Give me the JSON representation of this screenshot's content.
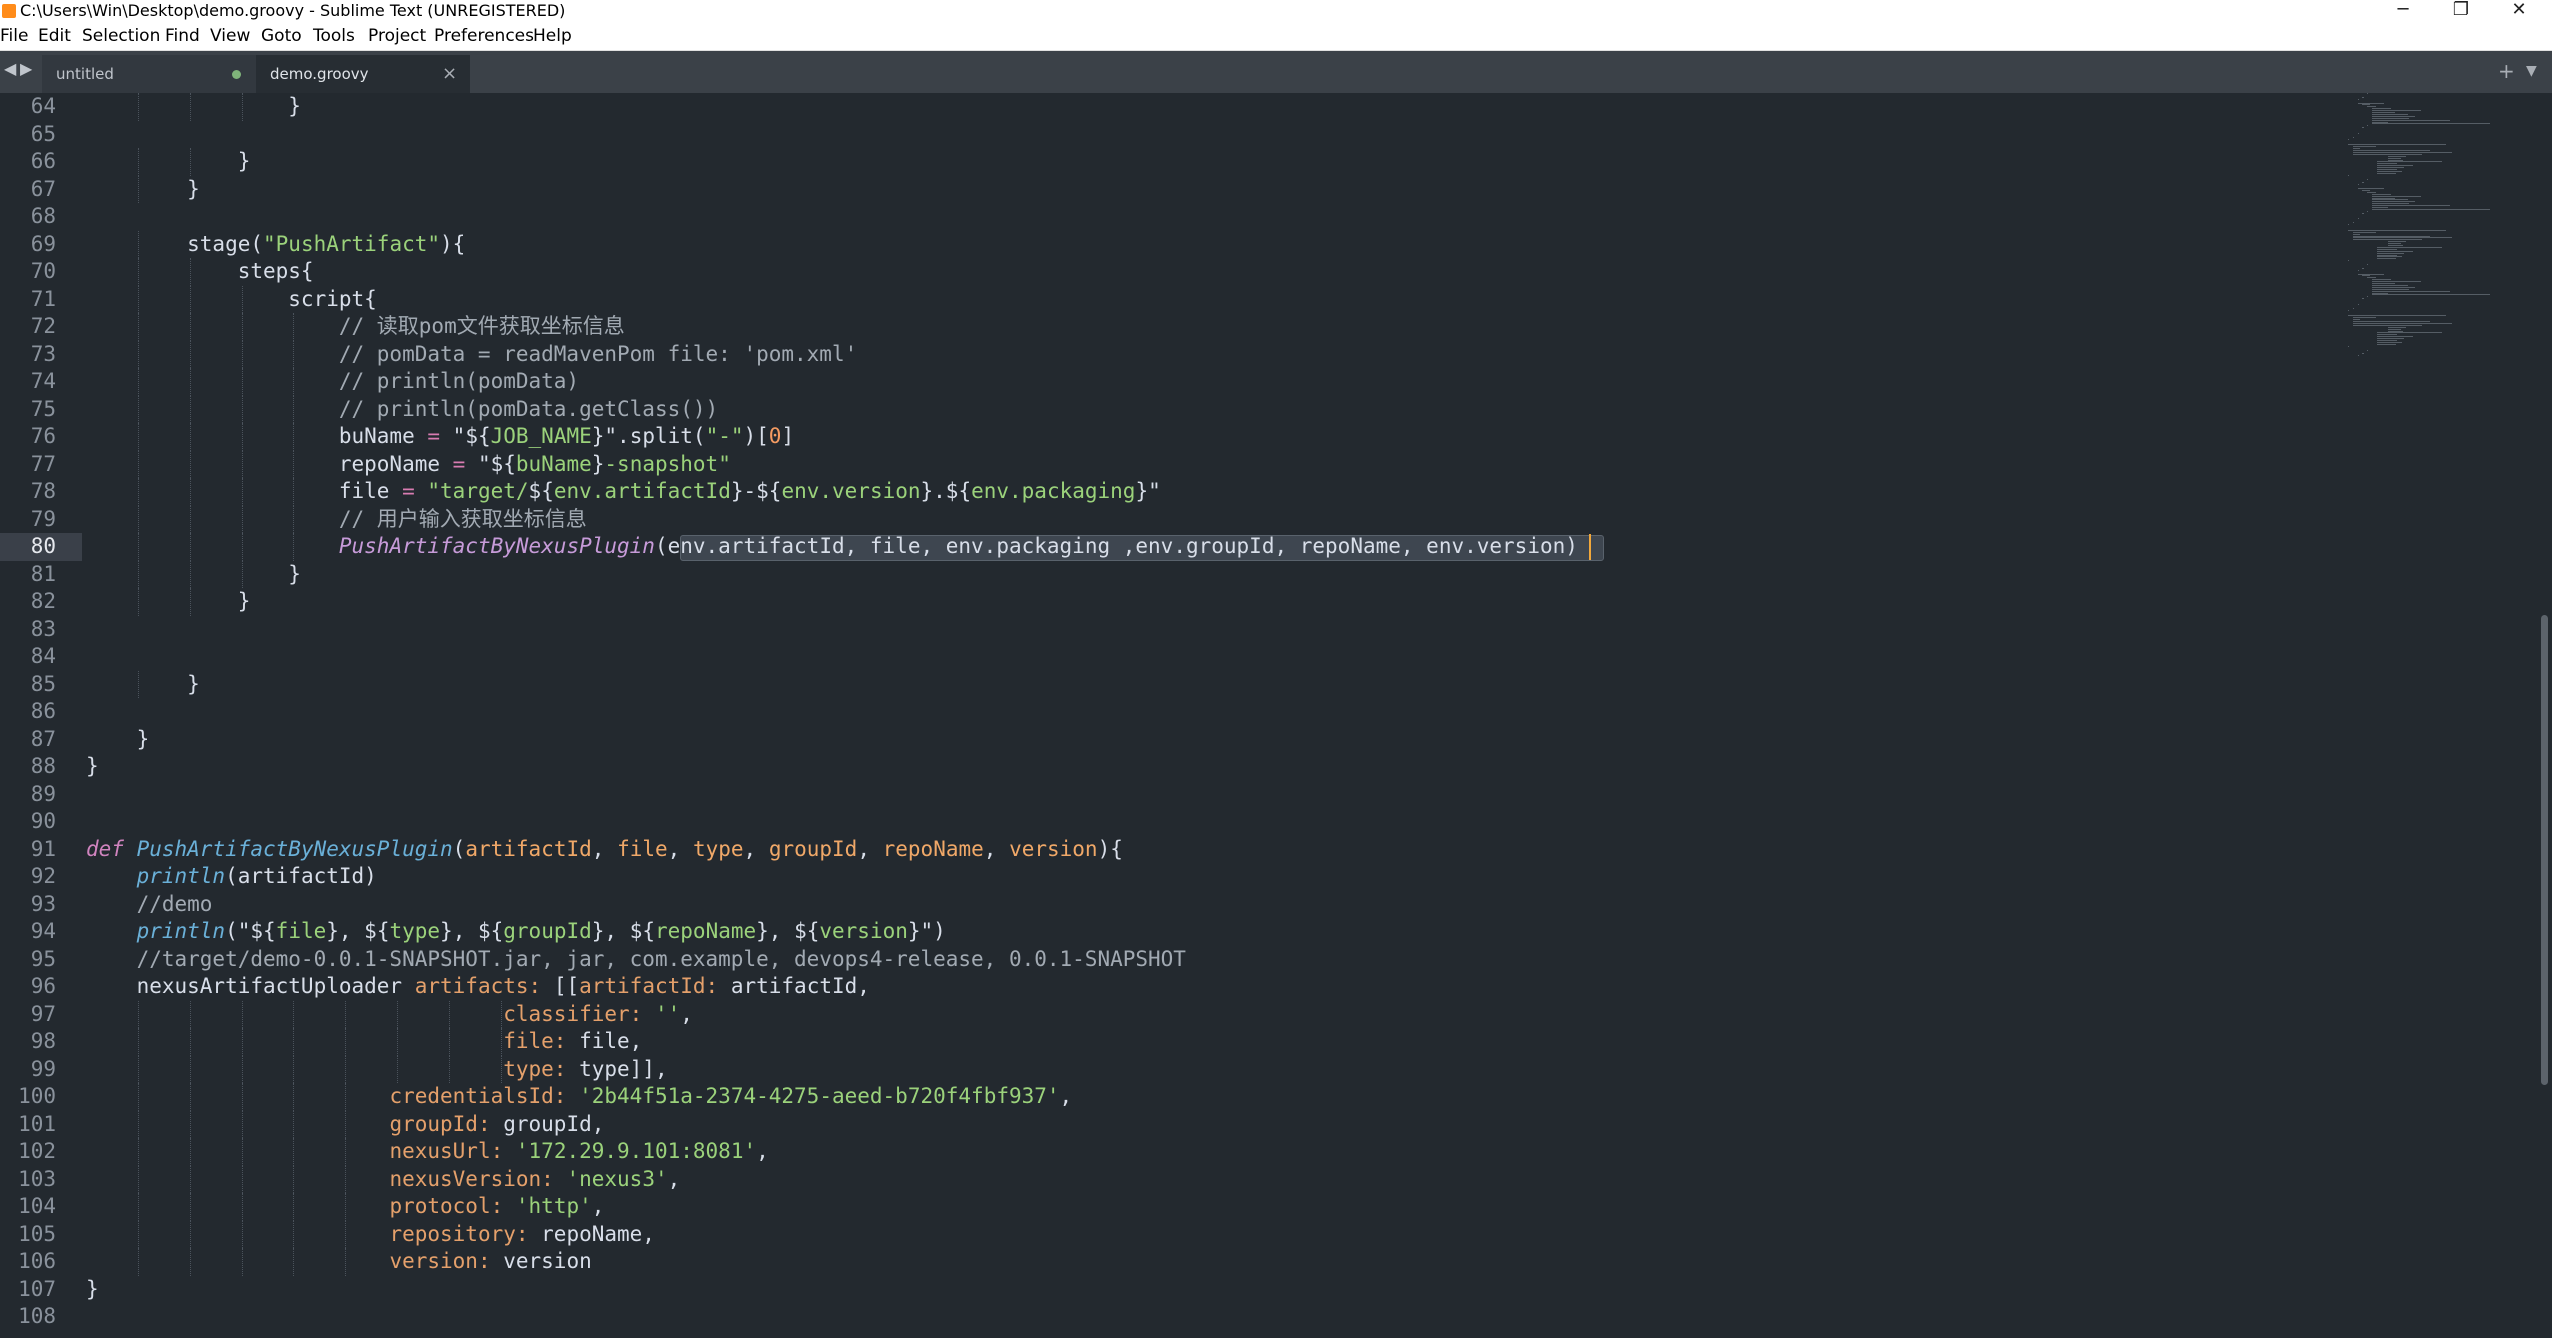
{
  "window": {
    "title": "C:\\Users\\Win\\Desktop\\demo.groovy - Sublime Text (UNREGISTERED)",
    "controls": {
      "minimize": "─",
      "maximize": "❐",
      "close": "✕"
    }
  },
  "menu": [
    "File",
    "Edit",
    "Selection",
    "Find",
    "View",
    "Goto",
    "Tools",
    "Project",
    "Preferences",
    "Help"
  ],
  "tabs": {
    "nav_back": "◀",
    "nav_forward": "▶",
    "items": [
      {
        "label": "untitled",
        "active": false,
        "dirty": true
      },
      {
        "label": "demo.groovy",
        "active": true,
        "close": "×"
      }
    ],
    "new_tab": "+",
    "tab_list": "▼"
  },
  "editor": {
    "current_line": 80,
    "line_numbers": [
      64,
      65,
      66,
      67,
      68,
      69,
      70,
      71,
      72,
      73,
      74,
      75,
      76,
      77,
      78,
      79,
      80,
      81,
      82,
      83,
      84,
      85,
      86,
      87,
      88,
      89,
      90,
      91,
      92,
      93,
      94,
      95,
      96,
      97,
      98,
      99,
      100,
      101,
      102,
      103,
      104,
      105,
      106,
      107,
      108
    ],
    "lines": [
      [
        {
          "t": "                }"
        }
      ],
      [],
      [
        {
          "t": "            }"
        }
      ],
      [
        {
          "t": "        }"
        }
      ],
      [],
      [
        {
          "t": "        stage("
        },
        {
          "t": "\"PushArtifact\"",
          "c": "str"
        },
        {
          "t": "){"
        }
      ],
      [
        {
          "t": "            steps{"
        }
      ],
      [
        {
          "t": "                script{"
        }
      ],
      [
        {
          "t": "                    // 读取pom文件获取坐标信息",
          "c": "com"
        }
      ],
      [
        {
          "t": "                    // pomData = readMavenPom file: 'pom.xml'",
          "c": "com"
        }
      ],
      [
        {
          "t": "                    // println(pomData)",
          "c": "com"
        }
      ],
      [
        {
          "t": "                    // println(pomData.getClass())",
          "c": "com"
        }
      ],
      [
        {
          "t": "                    buName "
        },
        {
          "t": "=",
          "c": "op"
        },
        {
          "t": " \"${"
        },
        {
          "t": "JOB_NAME",
          "c": "str"
        },
        {
          "t": "}\".split("
        },
        {
          "t": "\"-\"",
          "c": "str"
        },
        {
          "t": ")["
        },
        {
          "t": "0",
          "c": "num"
        },
        {
          "t": "]"
        }
      ],
      [
        {
          "t": "                    repoName "
        },
        {
          "t": "=",
          "c": "op"
        },
        {
          "t": " \"${"
        },
        {
          "t": "buName",
          "c": "str"
        },
        {
          "t": "}"
        },
        {
          "t": "-snapshot\"",
          "c": "str"
        }
      ],
      [
        {
          "t": "                    file "
        },
        {
          "t": "=",
          "c": "op"
        },
        {
          "t": " "
        },
        {
          "t": "\"target/",
          "c": "str"
        },
        {
          "t": "${"
        },
        {
          "t": "env.artifactId",
          "c": "str"
        },
        {
          "t": "}-${"
        },
        {
          "t": "env.version",
          "c": "str"
        },
        {
          "t": "}.${"
        },
        {
          "t": "env.packaging",
          "c": "str"
        },
        {
          "t": "}\""
        }
      ],
      [
        {
          "t": "                    // 用户输入获取坐标信息",
          "c": "com"
        }
      ],
      [
        {
          "t": "                    "
        },
        {
          "t": "PushArtifactByNexusPlugin",
          "c": "fn"
        },
        {
          "t": "(env.artifactId, file, env.packaging ,env.groupId, repoName, env.version)"
        }
      ],
      [
        {
          "t": "                }"
        }
      ],
      [
        {
          "t": "            }"
        }
      ],
      [],
      [],
      [
        {
          "t": "        }"
        }
      ],
      [],
      [
        {
          "t": "    }"
        }
      ],
      [
        {
          "t": "}"
        }
      ],
      [],
      [],
      [
        {
          "t": "def",
          "c": "def"
        },
        {
          "t": " "
        },
        {
          "t": "PushArtifactByNexusPlugin",
          "c": "bl"
        },
        {
          "t": "("
        },
        {
          "t": "artifactId",
          "c": "var"
        },
        {
          "t": ", "
        },
        {
          "t": "file",
          "c": "var"
        },
        {
          "t": ", "
        },
        {
          "t": "type",
          "c": "var"
        },
        {
          "t": ", "
        },
        {
          "t": "groupId",
          "c": "var"
        },
        {
          "t": ", "
        },
        {
          "t": "repoName",
          "c": "var"
        },
        {
          "t": ", "
        },
        {
          "t": "version",
          "c": "var"
        },
        {
          "t": "){"
        }
      ],
      [
        {
          "t": "    "
        },
        {
          "t": "println",
          "c": "bl"
        },
        {
          "t": "(artifactId)"
        }
      ],
      [
        {
          "t": "    //demo",
          "c": "com"
        }
      ],
      [
        {
          "t": "    "
        },
        {
          "t": "println",
          "c": "bl"
        },
        {
          "t": "(\"${"
        },
        {
          "t": "file",
          "c": "str"
        },
        {
          "t": "}, ${"
        },
        {
          "t": "type",
          "c": "str"
        },
        {
          "t": "}, ${"
        },
        {
          "t": "groupId",
          "c": "str"
        },
        {
          "t": "}, ${"
        },
        {
          "t": "repoName",
          "c": "str"
        },
        {
          "t": "}, ${"
        },
        {
          "t": "version",
          "c": "str"
        },
        {
          "t": "}\")"
        }
      ],
      [
        {
          "t": "    //target/demo-0.0.1-SNAPSHOT.jar, jar, com.example, devops4-release, 0.0.1-SNAPSHOT",
          "c": "com"
        }
      ],
      [
        {
          "t": "    nexusArtifactUploader "
        },
        {
          "t": "artifacts:",
          "c": "key"
        },
        {
          "t": " [["
        },
        {
          "t": "artifactId:",
          "c": "key"
        },
        {
          "t": " artifactId,"
        }
      ],
      [
        {
          "t": "                                 "
        },
        {
          "t": "classifier:",
          "c": "key"
        },
        {
          "t": " "
        },
        {
          "t": "''",
          "c": "str"
        },
        {
          "t": ","
        }
      ],
      [
        {
          "t": "                                 "
        },
        {
          "t": "file:",
          "c": "key"
        },
        {
          "t": " file,"
        }
      ],
      [
        {
          "t": "                                 "
        },
        {
          "t": "type:",
          "c": "key"
        },
        {
          "t": " type]],"
        }
      ],
      [
        {
          "t": "                        "
        },
        {
          "t": "credentialsId:",
          "c": "key"
        },
        {
          "t": " "
        },
        {
          "t": "'2b44f51a-2374-4275-aeed-b720f4fbf937'",
          "c": "str"
        },
        {
          "t": ","
        }
      ],
      [
        {
          "t": "                        "
        },
        {
          "t": "groupId:",
          "c": "key"
        },
        {
          "t": " groupId,"
        }
      ],
      [
        {
          "t": "                        "
        },
        {
          "t": "nexusUrl:",
          "c": "key"
        },
        {
          "t": " "
        },
        {
          "t": "'172.29.9.101:8081'",
          "c": "str"
        },
        {
          "t": ","
        }
      ],
      [
        {
          "t": "                        "
        },
        {
          "t": "nexusVersion:",
          "c": "key"
        },
        {
          "t": " "
        },
        {
          "t": "'nexus3'",
          "c": "str"
        },
        {
          "t": ","
        }
      ],
      [
        {
          "t": "                        "
        },
        {
          "t": "protocol:",
          "c": "key"
        },
        {
          "t": " "
        },
        {
          "t": "'http'",
          "c": "str"
        },
        {
          "t": ","
        }
      ],
      [
        {
          "t": "                        "
        },
        {
          "t": "repository:",
          "c": "key"
        },
        {
          "t": " repoName,"
        }
      ],
      [
        {
          "t": "                        "
        },
        {
          "t": "version:",
          "c": "key"
        },
        {
          "t": " version"
        }
      ],
      [
        {
          "t": "}"
        }
      ],
      []
    ]
  }
}
